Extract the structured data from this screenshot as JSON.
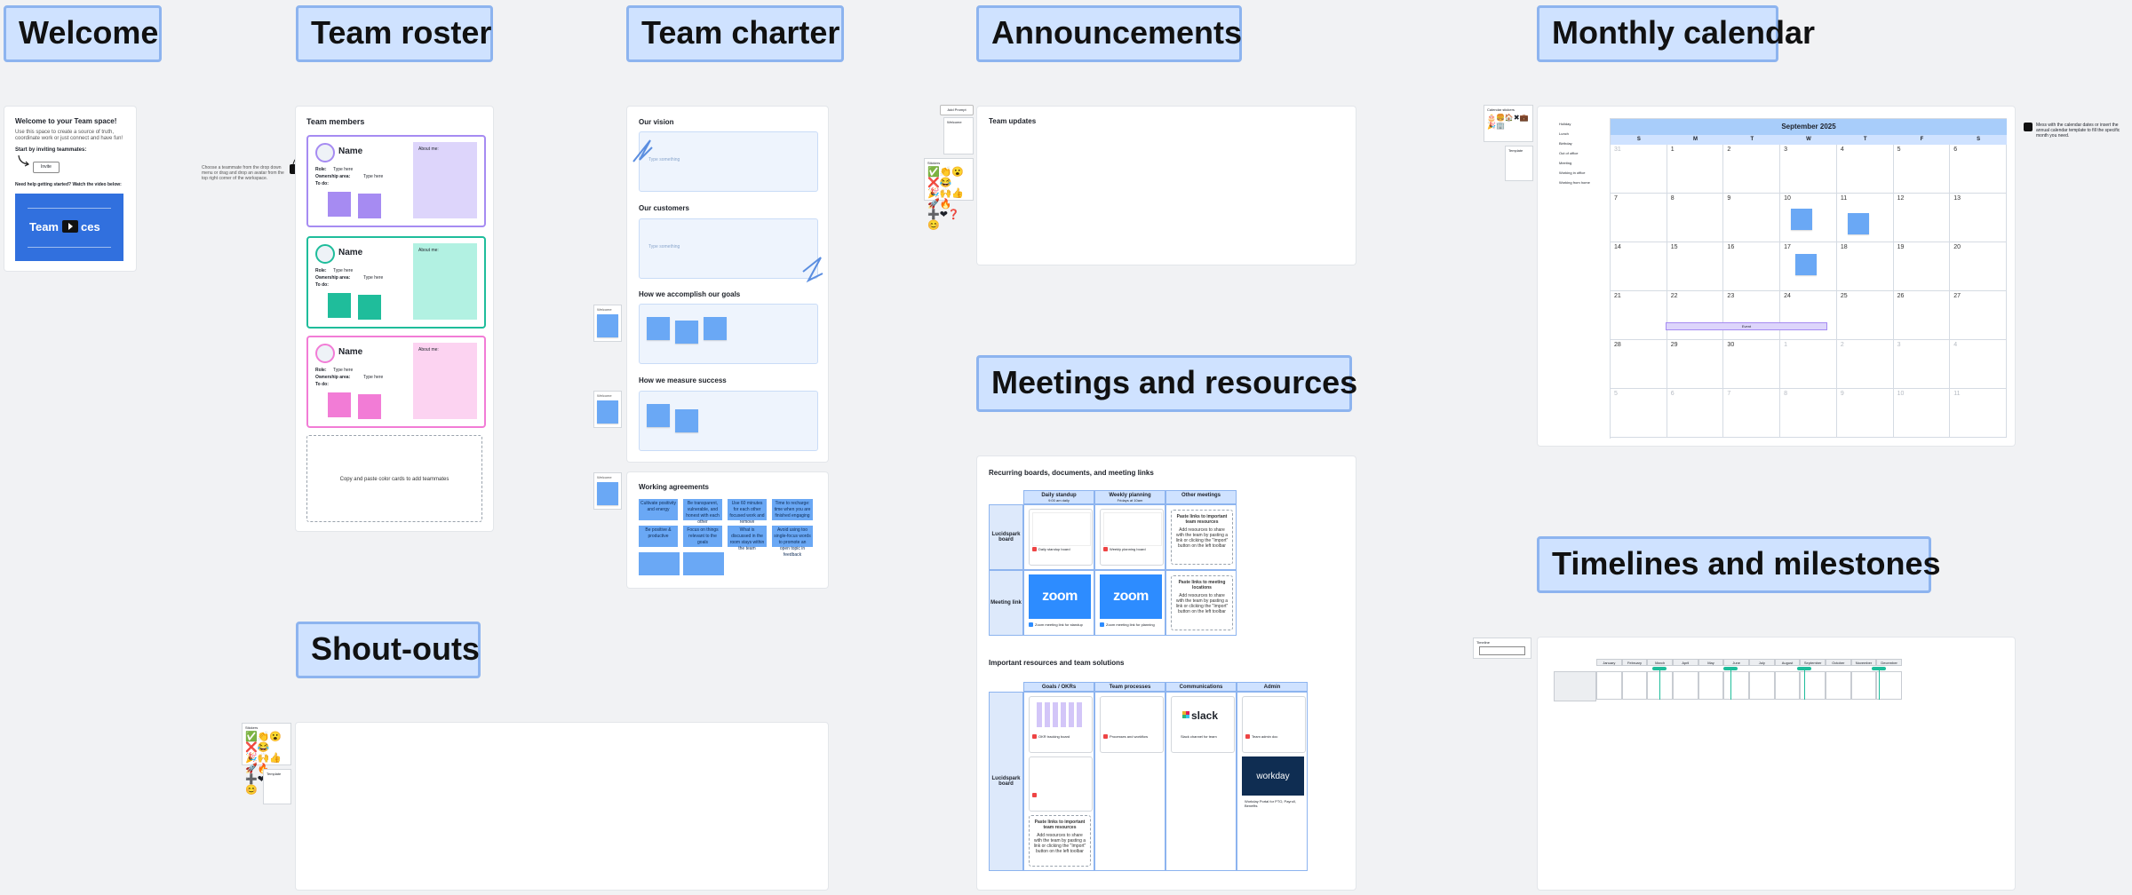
{
  "section_titles": {
    "welcome": "Welcome",
    "team_roster": "Team roster",
    "team_charter": "Team charter",
    "announcements": "Announcements",
    "monthly_calendar": "Monthly calendar",
    "meetings": "Meetings and resources",
    "timelines": "Timelines and milestones",
    "shoutouts": "Shout-outs"
  },
  "welcome": {
    "heading": "Welcome to your Team space!",
    "body": "Use this space to create a source of truth, coordinate work or just connect and have fun!",
    "start": "Start by inviting teammates:",
    "invite_button": "Invite",
    "help": "Need help getting started? Watch the video below:",
    "video_text_left": "Team",
    "video_text_right": "ces"
  },
  "roster": {
    "heading": "Team members",
    "hint": "Choose a teammate from the drop down menu or drag and drop an avatar from the top right corner of the workspace.",
    "cards": [
      {
        "name": "Name",
        "role_label": "Role:",
        "role_val": "Type here",
        "ownership_label": "Ownership area:",
        "ownership_val": "Type here",
        "todo": "To do:",
        "about": "About me:",
        "color": "#a68bf2",
        "tint": "#ddd5fb"
      },
      {
        "name": "Name",
        "role_label": "Role:",
        "role_val": "Type here",
        "ownership_label": "Ownership area:",
        "ownership_val": "Type here",
        "todo": "To do:",
        "about": "About me:",
        "color": "#1fbd9b",
        "tint": "#b2f1e2"
      },
      {
        "name": "Name",
        "role_label": "Role:",
        "role_val": "Type here",
        "ownership_label": "Ownership area:",
        "ownership_val": "Type here",
        "todo": "To do:",
        "about": "About me:",
        "color": "#f27cd6",
        "tint": "#fcd3f1"
      }
    ],
    "copy_hint": "Copy and paste color cards to add teammates"
  },
  "charter": {
    "vision": "Our vision",
    "customers": "Our customers",
    "goals": "How we accomplish our goals",
    "success": "How we measure success",
    "placeholder": "Type something",
    "working": "Working agreements",
    "side_label": "Welcome",
    "agreements": [
      "Cultivate positivity and energy",
      "Be transparent, vulnerable, and honest with each other",
      "Use 60 minutes for each other focused work and remove distractions",
      "Time to recharge: time when you are finished engaging",
      "Be positive & productive",
      "Focus on things relevant to the goals",
      "What is discussed in the room stays within the team",
      "Avoid using too single-focus words to promote an open topic in feedback",
      "",
      ""
    ]
  },
  "announcements": {
    "heading": "Team updates",
    "tool_label": "Add Prompt",
    "stickers_label": "Stickers",
    "template_label": "Welcome"
  },
  "calendar": {
    "month": "September 2025",
    "days": [
      "S",
      "M",
      "T",
      "W",
      "T",
      "F",
      "S"
    ],
    "sidebar": [
      "Holiday",
      "Lunch",
      "Birthday",
      "Out of office",
      "Meeting",
      "Working in office",
      "Working from home"
    ],
    "hint": "Mess with the calendar dates or insert the annual calendar template to fill the specific month you need.",
    "event": "Event",
    "weeks": [
      [
        "31",
        "1",
        "2",
        "3",
        "4",
        "5",
        "6"
      ],
      [
        "7",
        "8",
        "9",
        "10",
        "11",
        "12",
        "13"
      ],
      [
        "14",
        "15",
        "16",
        "17",
        "18",
        "19",
        "20"
      ],
      [
        "21",
        "22",
        "23",
        "24",
        "25",
        "26",
        "27"
      ],
      [
        "28",
        "29",
        "30",
        "1",
        "2",
        "3",
        "4"
      ],
      [
        "5",
        "6",
        "7",
        "8",
        "9",
        "10",
        "11"
      ]
    ],
    "label_sticker_box": "Calendar stickers",
    "label_template": "Template"
  },
  "meetings": {
    "recurring_heading": "Recurring boards, documents, and meeting links",
    "col_headers": [
      "Daily standup",
      "Weekly planning",
      "Other meetings"
    ],
    "col_subs": [
      "9:00 am daily",
      "Fridays at 10am",
      ""
    ],
    "row_headers": [
      "Lucidspark board",
      "Meeting link"
    ],
    "doc_title_1": "Daily standup board",
    "doc_title_2": "Weekly planning board",
    "paste_links": "Paste links to important team resources",
    "paste_body": "Add resources to share with the team by pasting a link or clicking the \"Import\" button on the left toolbar",
    "paste_meeting": "Paste links to meeting locations",
    "paste_meeting_body": "Add resources to share with the team by pasting a link or clicking the \"Import\" button on the left toolbar",
    "zoom": "zoom",
    "zoom_cap_1": "Zoom meeting link for standup",
    "zoom_cap_2": "Zoom meeting link for planning",
    "resources_heading": "Important resources and team solutions",
    "res_cols": [
      "Goals / OKRs",
      "Team processes",
      "Communications",
      "Admin"
    ],
    "res_row": "Lucidspark board",
    "okr_title": "OKR tracking board",
    "process_title": "Processes and workflow",
    "slack_title": "Slack channel for team",
    "admin_title": "Team admin doc",
    "slack": "slack",
    "workday": "workday",
    "workday_cap": "Workday Portal for PTO, Payroll, Benefits"
  },
  "timelines": {
    "tool_label": "Timeline",
    "months": [
      "January",
      "February",
      "March",
      "April",
      "May",
      "June",
      "July",
      "August",
      "September",
      "October",
      "November",
      "December"
    ]
  },
  "shoutouts": {
    "stickers_label": "Stickers",
    "template_label": "Template"
  },
  "emojis": [
    "✅",
    "👏",
    "😮",
    "❌",
    "😂",
    "🎉",
    "🙌",
    "👍",
    "🚀",
    "🔥",
    "➕",
    "❤",
    "❓",
    "😊",
    "⭐"
  ],
  "colors": {
    "title_bg": "#cfe2ff",
    "title_border": "#8db4ef",
    "sticky_blue": "#6aa8f5",
    "calendar_header": "#a8cdfa"
  }
}
